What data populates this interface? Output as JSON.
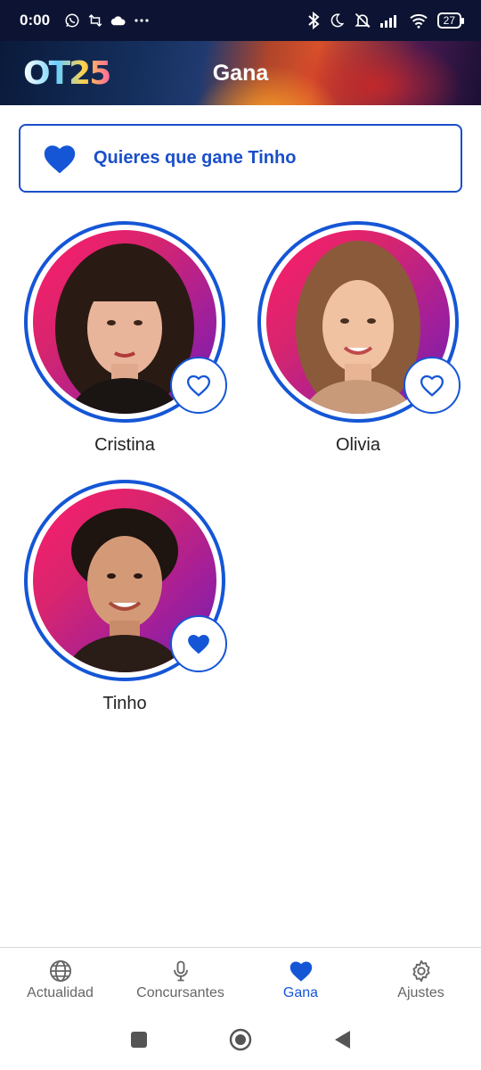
{
  "status_bar": {
    "time": "0:00",
    "battery": "27",
    "icons_left": [
      "whatsapp-icon",
      "retweet-icon",
      "cloud-icon",
      "more-icon"
    ],
    "icons_right": [
      "bluetooth-icon",
      "moon-icon",
      "mute-icon",
      "signal-icon",
      "wifi-icon",
      "battery-icon"
    ]
  },
  "header": {
    "logo": "OT25",
    "title": "Gana"
  },
  "banner": {
    "text": "Quieres que gane Tinho",
    "icon": "heart-filled-icon"
  },
  "contestants": [
    {
      "name": "Cristina",
      "favorite": false
    },
    {
      "name": "Olivia",
      "favorite": false
    },
    {
      "name": "Tinho",
      "favorite": true
    }
  ],
  "bottom_nav": {
    "items": [
      {
        "label": "Actualidad",
        "icon": "globe-icon",
        "active": false
      },
      {
        "label": "Concursantes",
        "icon": "microphone-icon",
        "active": false
      },
      {
        "label": "Gana",
        "icon": "heart-icon",
        "active": true
      },
      {
        "label": "Ajustes",
        "icon": "gear-icon",
        "active": false
      }
    ]
  },
  "colors": {
    "accent": "#1556d6",
    "header_dark": "#0d1433",
    "nav_inactive": "#666666"
  }
}
